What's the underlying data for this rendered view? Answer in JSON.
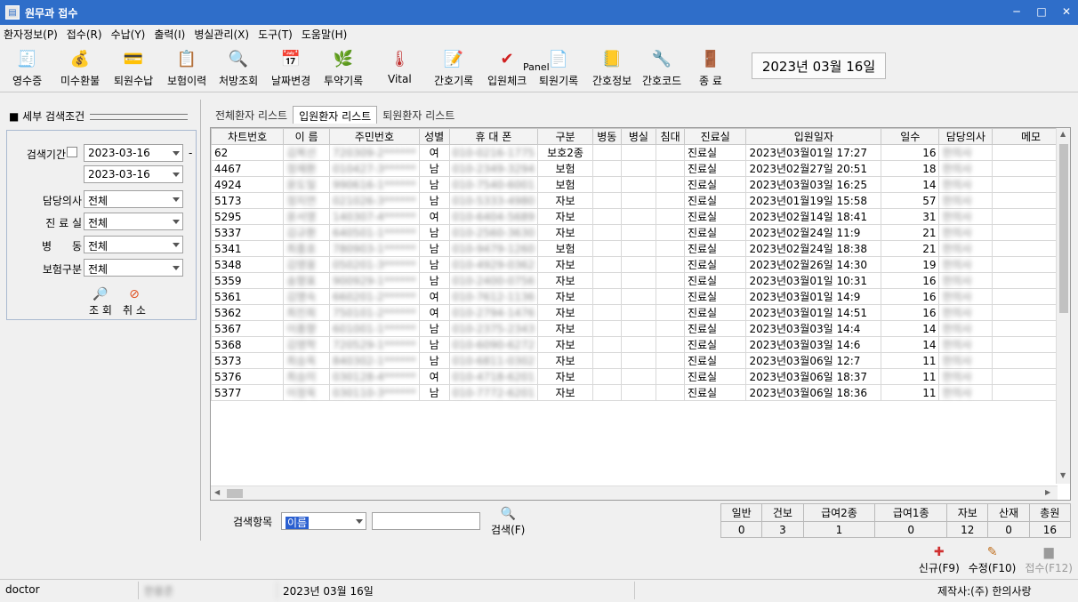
{
  "window": {
    "title": "원무과 접수"
  },
  "menu": [
    "환자정보(P)",
    "접수(R)",
    "수납(Y)",
    "출력(I)",
    "병실관리(X)",
    "도구(T)",
    "도움말(H)"
  ],
  "toolbar": {
    "items": [
      {
        "label": "영수증",
        "icon": "receipt-icon"
      },
      {
        "label": "미수환불",
        "icon": "refund-icon"
      },
      {
        "label": "퇴원수납",
        "icon": "discharge-payment-icon"
      },
      {
        "label": "보험이력",
        "icon": "insurance-history-icon"
      },
      {
        "label": "처방조회",
        "icon": "search-icon"
      },
      {
        "label": "날짜변경",
        "icon": "calendar-icon"
      },
      {
        "label": "투약기록",
        "icon": "medication-icon"
      },
      {
        "label": "Vital",
        "icon": "thermometer-icon"
      },
      {
        "label": "간호기록",
        "icon": "nursing-record-icon"
      },
      {
        "label": "입원체크",
        "icon": "check-icon"
      },
      {
        "label": "퇴원기록",
        "icon": "discharge-record-icon"
      },
      {
        "label": "간호정보",
        "icon": "nursing-info-icon"
      },
      {
        "label": "간호코드",
        "icon": "tools-icon"
      },
      {
        "label": "종 료",
        "icon": "exit-door-icon"
      }
    ],
    "panel_text": "Panel",
    "date": "2023년  03월  16일"
  },
  "left_panel": {
    "title": "세부 검색조건",
    "period_label": "검색기간",
    "date_from": "2023-03-16",
    "date_to": "2023-03-16",
    "dash": "-",
    "doctor_label": "담당의사",
    "doctor_value": "전체",
    "clinic_label": "진 료 실",
    "clinic_value": "전체",
    "ward_label": "병      동",
    "ward_value": "전체",
    "insurance_label": "보험구분",
    "insurance_value": "전체",
    "search_btn": "조 회",
    "cancel_btn": "취 소"
  },
  "tabs": [
    "전체환자 리스트",
    "입원환자 리스트",
    "퇴원환자 리스트"
  ],
  "grid": {
    "columns": [
      "차트번호",
      "이  름",
      "주민번호",
      "성별",
      "휴 대 폰",
      "구분",
      "병동",
      "병실",
      "침대",
      "진료실",
      "입원일자",
      "일수",
      "담당의사",
      "메모"
    ],
    "rows": [
      [
        "62",
        "김복선",
        "720309-2******",
        "여",
        "010-0216-1775",
        "보호2종",
        "",
        "",
        "",
        "진료실",
        "2023년03월01일  17:27",
        "16",
        "한의사",
        ""
      ],
      [
        "4467",
        "정재환",
        "010427-3******",
        "남",
        "010-2349-3294",
        "보험",
        "",
        "",
        "",
        "진료실",
        "2023년02월27일  20:51",
        "18",
        "한의사",
        ""
      ],
      [
        "4924",
        "윤도일",
        "990616-1******",
        "남",
        "010-7540-6001",
        "보험",
        "",
        "",
        "",
        "진료실",
        "2023년03월03일  16:25",
        "14",
        "한의사",
        ""
      ],
      [
        "5173",
        "정지연",
        "021026-3******",
        "남",
        "010-5333-4980",
        "자보",
        "",
        "",
        "",
        "진료실",
        "2023년01월19일  15:58",
        "57",
        "한의사",
        ""
      ],
      [
        "5295",
        "윤서영",
        "140307-4******",
        "여",
        "010-6404-5689",
        "자보",
        "",
        "",
        "",
        "진료실",
        "2023년02월14일  18:41",
        "31",
        "한의사",
        ""
      ],
      [
        "5337",
        "김규환",
        "640501-1******",
        "남",
        "010-2560-3630",
        "자보",
        "",
        "",
        "",
        "진료실",
        "2023년02월24일  11:9",
        "21",
        "한의사",
        ""
      ],
      [
        "5341",
        "최흥호",
        "780903-1******",
        "남",
        "010-9479-1260",
        "보험",
        "",
        "",
        "",
        "진료실",
        "2023년02월24일  18:38",
        "21",
        "한의사",
        ""
      ],
      [
        "5348",
        "김영웅",
        "050201-3******",
        "남",
        "010-4929-0362",
        "자보",
        "",
        "",
        "",
        "진료실",
        "2023년02월26일  14:30",
        "19",
        "한의사",
        ""
      ],
      [
        "5359",
        "송향표",
        "900929-1******",
        "남",
        "010-2400-0756",
        "자보",
        "",
        "",
        "",
        "진료실",
        "2023년03월01일  10:31",
        "16",
        "한의사",
        ""
      ],
      [
        "5361",
        "김명숙",
        "660201-2******",
        "여",
        "010-7612-1136",
        "자보",
        "",
        "",
        "",
        "진료실",
        "2023년03월01일  14:9",
        "16",
        "한의사",
        ""
      ],
      [
        "5362",
        "최진희",
        "750101-2******",
        "여",
        "010-2794-1476",
        "자보",
        "",
        "",
        "",
        "진료실",
        "2023년03월01일  14:51",
        "16",
        "한의사",
        ""
      ],
      [
        "5367",
        "이종향",
        "601001-1******",
        "남",
        "010-2375-2343",
        "자보",
        "",
        "",
        "",
        "진료실",
        "2023년03월03일  14:4",
        "14",
        "한의사",
        ""
      ],
      [
        "5368",
        "김영학",
        "720529-1******",
        "남",
        "010-6090-6272",
        "자보",
        "",
        "",
        "",
        "진료실",
        "2023년03월03일  14:6",
        "14",
        "한의사",
        ""
      ],
      [
        "5373",
        "최승옥",
        "840302-1******",
        "남",
        "010-6811-0302",
        "자보",
        "",
        "",
        "",
        "진료실",
        "2023년03월06일  12:7",
        "11",
        "한의사",
        ""
      ],
      [
        "5376",
        "최승미",
        "030128-4******",
        "여",
        "010-4718-6201",
        "자보",
        "",
        "",
        "",
        "진료실",
        "2023년03월06일  18:37",
        "11",
        "한의사",
        ""
      ],
      [
        "5377",
        "이정욱",
        "030110-3******",
        "남",
        "010-7772-6201",
        "자보",
        "",
        "",
        "",
        "진료실",
        "2023년03월06일  18:36",
        "11",
        "한의사",
        ""
      ]
    ]
  },
  "bottom": {
    "search_label": "검색항목",
    "search_field_value": "이름",
    "search_input_value": "",
    "search_button": "검색(F)"
  },
  "counts": {
    "headers": [
      "일반",
      "건보",
      "급여2종",
      "급여1종",
      "자보",
      "산재",
      "총원"
    ],
    "values": [
      "0",
      "3",
      "1",
      "0",
      "12",
      "0",
      "16"
    ]
  },
  "actions": [
    {
      "label": "신규(F9)",
      "icon": "new-icon",
      "enabled": true
    },
    {
      "label": "수정(F10)",
      "icon": "edit-icon",
      "enabled": true
    },
    {
      "label": "접수(F12)",
      "icon": "register-icon",
      "enabled": false
    }
  ],
  "status": {
    "user": "doctor",
    "name": "한용준",
    "date": "2023년 03월 16일",
    "maker": "제작사:(주) 한의사랑"
  }
}
